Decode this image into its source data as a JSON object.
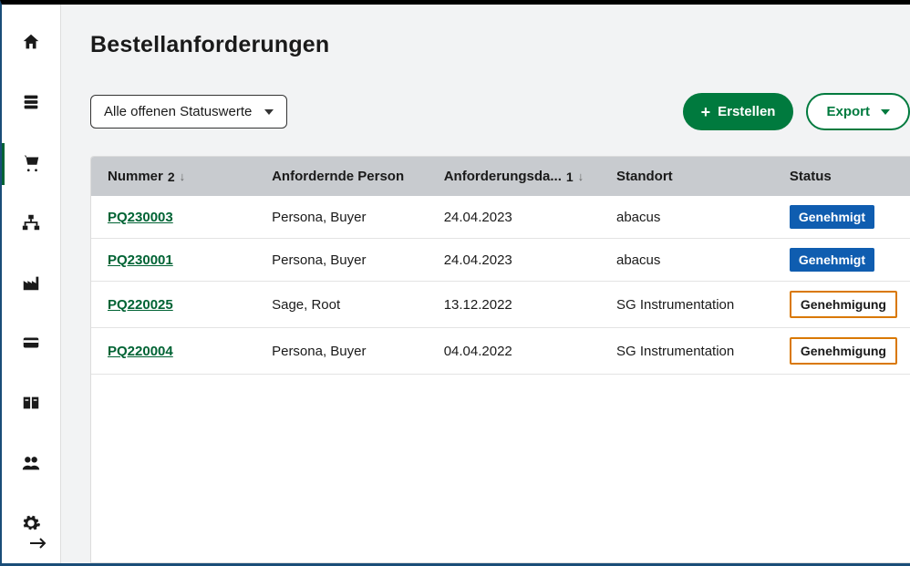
{
  "page": {
    "title": "Bestellanforderungen"
  },
  "toolbar": {
    "filter_label": "Alle offenen Statuswerte",
    "create_label": "Erstellen",
    "export_label": "Export"
  },
  "table": {
    "columns": {
      "nummer": "Nummer",
      "nummer_sort": "2",
      "person": "Anfordernde Person",
      "datum": "Anforderungsda...",
      "datum_sort": "1",
      "standort": "Standort",
      "status": "Status"
    },
    "rows": [
      {
        "nummer": "PQ230003",
        "person": "Persona, Buyer",
        "datum": "24.04.2023",
        "standort": "abacus",
        "status_label": "Genehmigt",
        "status_kind": "approved"
      },
      {
        "nummer": "PQ230001",
        "person": "Persona, Buyer",
        "datum": "24.04.2023",
        "standort": "abacus",
        "status_label": "Genehmigt",
        "status_kind": "approved"
      },
      {
        "nummer": "PQ220025",
        "person": "Sage, Root",
        "datum": "13.12.2022",
        "standort": "SG Instrumentation",
        "status_label": "Genehmigung ",
        "status_kind": "pending"
      },
      {
        "nummer": "PQ220004",
        "person": "Persona, Buyer",
        "datum": "04.04.2022",
        "standort": "SG Instrumentation",
        "status_label": "Genehmigung ",
        "status_kind": "pending"
      }
    ]
  }
}
